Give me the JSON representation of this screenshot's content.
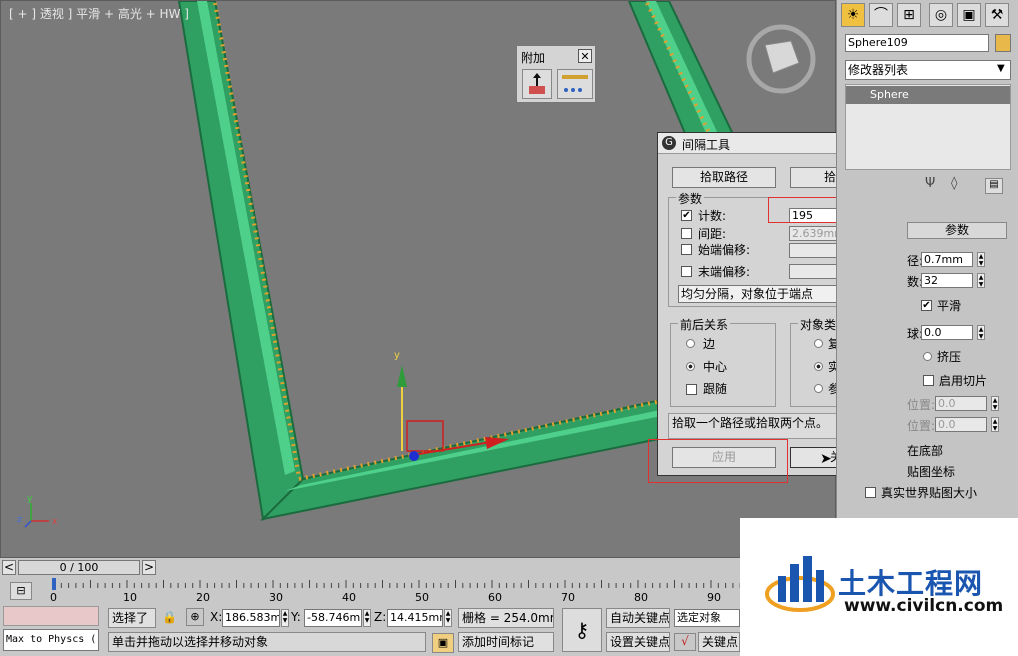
{
  "viewport": {
    "label": "[ + ] 透视 ] 平滑 + 高光 + HW ]",
    "gizmo_axis_y": "y",
    "axis_tripod": {
      "x": "x",
      "y": "y",
      "z": "z"
    }
  },
  "attach_floater": {
    "title": "附加"
  },
  "spacing_dialog": {
    "title": "间隔工具",
    "pick_path_label": "拾取路径",
    "pick_points_label": "拾取点",
    "params_group": "参数",
    "count_label": "计数:",
    "count_value": "195",
    "count_checked": true,
    "spacing_label": "间距:",
    "spacing_value": "2.639mm",
    "start_offset_label": "始端偏移:",
    "end_offset_label": "末端偏移:",
    "distribution_mode": "均匀分隔，对象位于端点",
    "context_group": "前后关系",
    "context_edges": "边",
    "context_centers": "中心",
    "context_follow": "跟随",
    "object_type_group": "对象类型",
    "type_copy": "复制",
    "type_instance": "实例",
    "type_reference": "参考",
    "status_text": "拾取一个路径或拾取两个点。",
    "apply_label": "应用",
    "close_label": "关闭"
  },
  "command_panel": {
    "object_name": "Sphere109",
    "object_color": "#e8b84a",
    "modifier_list_label": "修改器列表",
    "stack_item": "Sphere",
    "rollout_title": "参数",
    "radius_suffix": "径:",
    "radius_value": "0.7mm",
    "segments_suffix": "数:",
    "segments_value": "32",
    "smooth_label": "平滑",
    "hemisphere_suffix": "球:",
    "hemisphere_value": "0.0",
    "squash_label": "挤压",
    "enable_slice_label": "启用切片",
    "slice_from_suffix": "位置:",
    "slice_from_value": "0.0",
    "slice_to_suffix": "位置:",
    "slice_to_value": "0.0",
    "pivot_base_suffix": "在底部",
    "gen_mapping_suffix": "贴图坐标",
    "real_world_label": "真实世界贴图大小"
  },
  "timeline": {
    "frame_readout": "0 / 100",
    "prev_label": "<",
    "next_label": ">",
    "ticks": [
      "0",
      "10",
      "20",
      "30",
      "40",
      "50",
      "60",
      "70",
      "80",
      "90"
    ]
  },
  "status_bar": {
    "maxscript_text": "Max to Physcs (",
    "selection_label": "选择了",
    "x_label": "X:",
    "x_value": "186.583mm",
    "y_label": "Y:",
    "y_value": "-58.746mm",
    "z_label": "Z:",
    "z_value": "14.415mm",
    "grid_text": "栅格 = 254.0mm",
    "prompt_text": "单击并拖动以选择并移动对象",
    "add_time_tag": "添加时间标记",
    "auto_key": "自动关键点",
    "set_key": "设置关键点",
    "selected_object": "选定对象",
    "key_filters": "关键点"
  },
  "watermark": {
    "name": "土木工程网",
    "url": "www.civilcn.com",
    "brand_color": "#1a56b0"
  }
}
